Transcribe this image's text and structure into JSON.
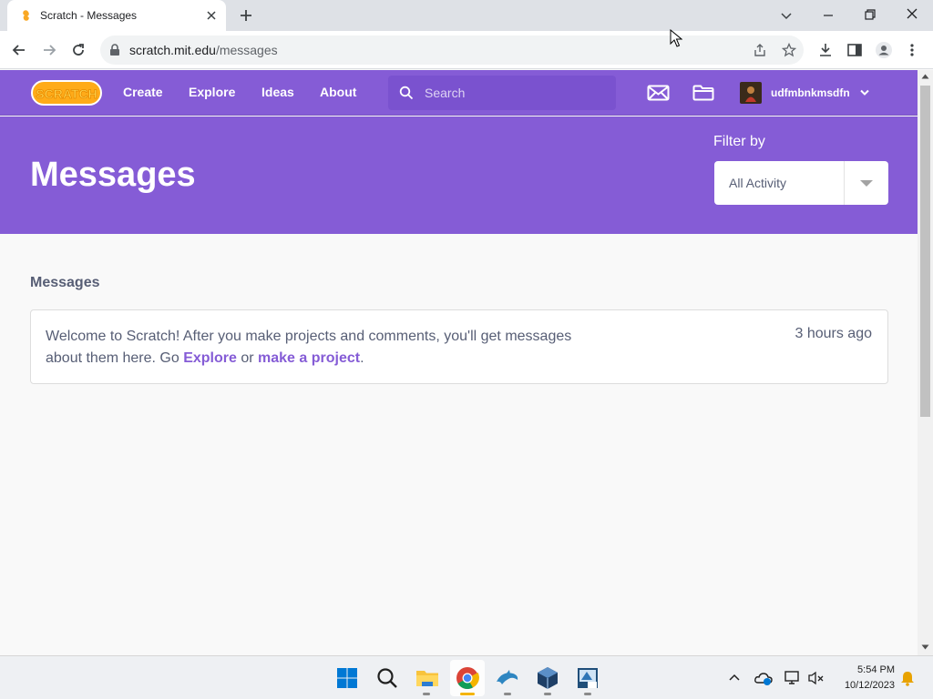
{
  "browser": {
    "tab_title": "Scratch - Messages",
    "url_domain": "scratch.mit.edu",
    "url_path": "/messages"
  },
  "nav": {
    "logo_text": "SCRATCH",
    "links": [
      "Create",
      "Explore",
      "Ideas",
      "About"
    ],
    "search_placeholder": "Search",
    "username": "udfmbnkmsdfn"
  },
  "header": {
    "title": "Messages",
    "filter_label": "Filter by",
    "filter_value": "All Activity"
  },
  "content": {
    "section_title": "Messages",
    "message": {
      "text_before": "Welcome to Scratch! After you make projects and comments, you'll get messages about them here. Go ",
      "link1": "Explore",
      "text_mid": " or ",
      "link2": "make a project",
      "text_after": ".",
      "time": "3 hours ago"
    }
  },
  "taskbar": {
    "time": "5:54 PM",
    "date": "10/12/2023"
  },
  "colors": {
    "scratch_purple": "#855cd6",
    "text_gray": "#575e75"
  }
}
